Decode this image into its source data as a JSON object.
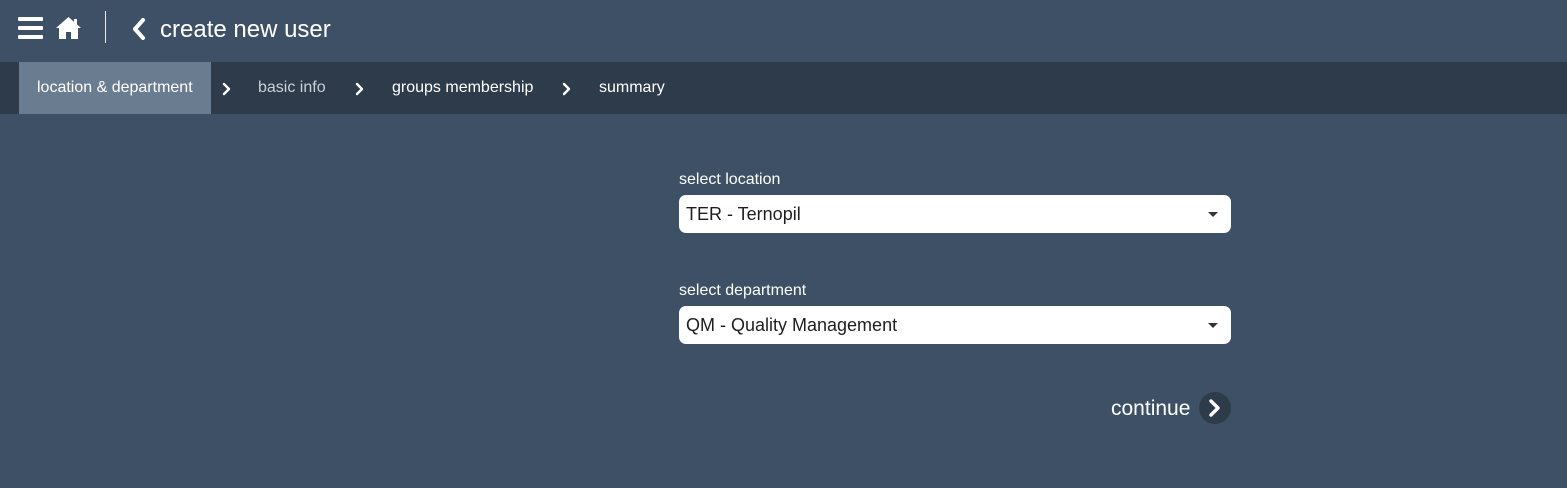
{
  "header": {
    "title": "create new user",
    "menu_icon": "hamburger-menu-icon",
    "home_icon": "home-icon",
    "back_icon": "chevron-left-icon"
  },
  "steps": [
    {
      "label": "location & department",
      "active": true
    },
    {
      "label": "basic info",
      "active": false
    },
    {
      "label": "groups membership",
      "active": false
    },
    {
      "label": "summary",
      "active": false
    }
  ],
  "form": {
    "location_label": "select location",
    "location_value": "TER - Ternopil",
    "department_label": "select department",
    "department_value": "QM - Quality Management"
  },
  "actions": {
    "continue_label": "continue"
  },
  "colors": {
    "background": "#3e5065",
    "stepbar": "#2e3b4a",
    "active_step": "#6a7c90"
  }
}
